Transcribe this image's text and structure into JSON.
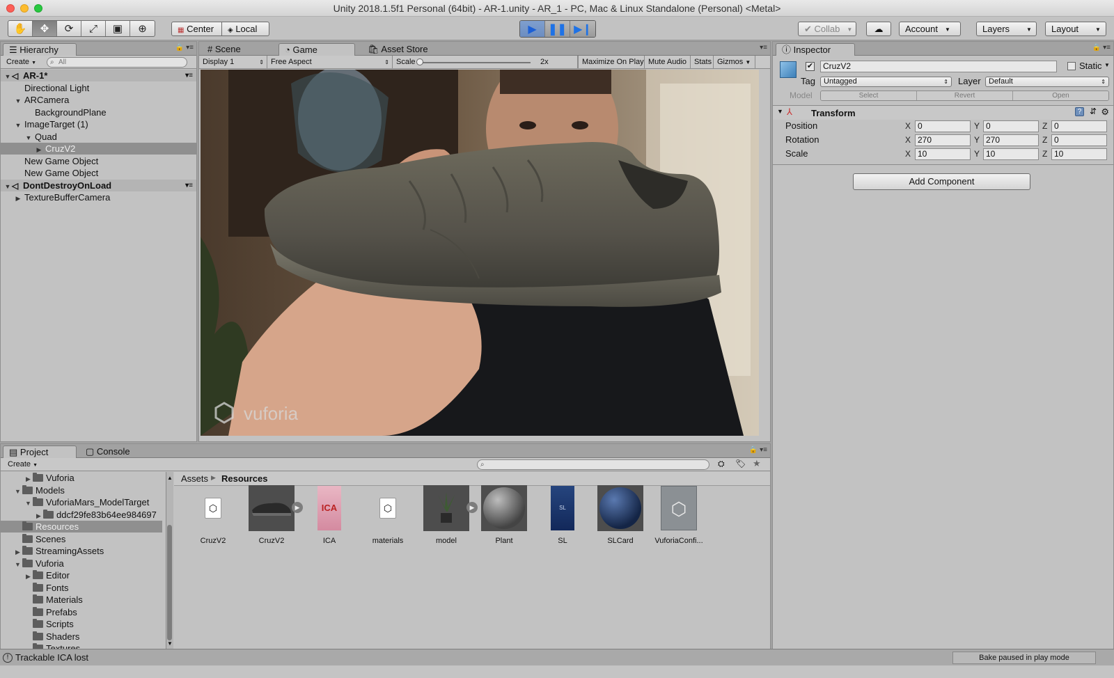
{
  "window": {
    "title": "Unity 2018.1.5f1 Personal (64bit) - AR-1.unity - AR_1 - PC, Mac & Linux Standalone (Personal) <Metal>"
  },
  "toolbar": {
    "tools": [
      "hand-tool",
      "move-tool",
      "rotate-tool",
      "scale-tool",
      "rect-tool",
      "transform-tool"
    ],
    "pivot_mode": "Center",
    "pivot_rotation": "Local",
    "collab": "Collab",
    "account": "Account",
    "layers": "Layers",
    "layout": "Layout"
  },
  "hierarchy": {
    "tab": "Hierarchy",
    "create": "Create",
    "search_placeholder": "All",
    "rows": [
      {
        "label": "AR-1*",
        "depth": 0,
        "type": "scene",
        "expanded": true
      },
      {
        "label": "Directional Light",
        "depth": 1
      },
      {
        "label": "ARCamera",
        "depth": 1,
        "expanded": true
      },
      {
        "label": "BackgroundPlane",
        "depth": 2
      },
      {
        "label": "ImageTarget (1)",
        "depth": 1,
        "expanded": true
      },
      {
        "label": "Quad",
        "depth": 2,
        "expanded": true
      },
      {
        "label": "CruzV2",
        "depth": 3,
        "collapsed": true,
        "selected": true
      },
      {
        "label": "New Game Object",
        "depth": 1
      },
      {
        "label": "New Game Object",
        "depth": 1
      },
      {
        "label": "DontDestroyOnLoad",
        "depth": 0,
        "type": "scene",
        "expanded": true
      },
      {
        "label": "TextureBufferCamera",
        "depth": 1,
        "collapsed": true
      }
    ]
  },
  "center": {
    "tabs": [
      "Scene",
      "Game",
      "Asset Store"
    ],
    "active_tab": "Game",
    "display": "Display 1",
    "aspect": "Free Aspect",
    "scale_label": "Scale",
    "scale_value": "2x",
    "maximize": "Maximize On Play",
    "mute": "Mute Audio",
    "stats": "Stats",
    "gizmos": "Gizmos",
    "watermark": "vuforia"
  },
  "inspector": {
    "tab": "Inspector",
    "object_name": "CruzV2",
    "static_label": "Static",
    "tag_label": "Tag",
    "tag_value": "Untagged",
    "layer_label": "Layer",
    "layer_value": "Default",
    "model_label": "Model",
    "model_buttons": [
      "Select",
      "Revert",
      "Open"
    ],
    "component": "Transform",
    "position": {
      "label": "Position",
      "x": "0",
      "y": "0",
      "z": "0"
    },
    "rotation": {
      "label": "Rotation",
      "x": "270",
      "y": "270",
      "z": "0"
    },
    "scale": {
      "label": "Scale",
      "x": "10",
      "y": "10",
      "z": "10"
    },
    "add_component": "Add Component"
  },
  "project": {
    "tabs": [
      "Project",
      "Console"
    ],
    "create": "Create",
    "breadcrumb": [
      "Assets",
      "Resources"
    ],
    "tree": [
      {
        "label": "Vuforia",
        "depth": 1,
        "collapsed": true
      },
      {
        "label": "Models",
        "depth": 0,
        "expanded": true
      },
      {
        "label": "VuforiaMars_ModelTarget",
        "depth": 1,
        "expanded": true
      },
      {
        "label": "ddcf29fe83b64ee984697",
        "depth": 2,
        "collapsed": true
      },
      {
        "label": "Resources",
        "depth": 0,
        "selected": true
      },
      {
        "label": "Scenes",
        "depth": 0
      },
      {
        "label": "StreamingAssets",
        "depth": 0,
        "collapsed": true
      },
      {
        "label": "Vuforia",
        "depth": 0,
        "expanded": true
      },
      {
        "label": "Editor",
        "depth": 1,
        "collapsed": true
      },
      {
        "label": "Fonts",
        "depth": 1
      },
      {
        "label": "Materials",
        "depth": 1
      },
      {
        "label": "Prefabs",
        "depth": 1
      },
      {
        "label": "Scripts",
        "depth": 1
      },
      {
        "label": "Shaders",
        "depth": 1
      },
      {
        "label": "Textures",
        "depth": 1
      }
    ],
    "assets": [
      "CruzV2",
      "CruzV2",
      "ICA",
      "materials",
      "model",
      "Plant",
      "SL",
      "SLCard",
      "VuforiaConfi..."
    ]
  },
  "status": {
    "message": "Trackable ICA lost",
    "bake": "Bake paused in play mode"
  },
  "colors": {
    "panel_bg": "#c2c2c2",
    "selection": "#8f8f8f",
    "play_blue": "#1e72e6"
  }
}
